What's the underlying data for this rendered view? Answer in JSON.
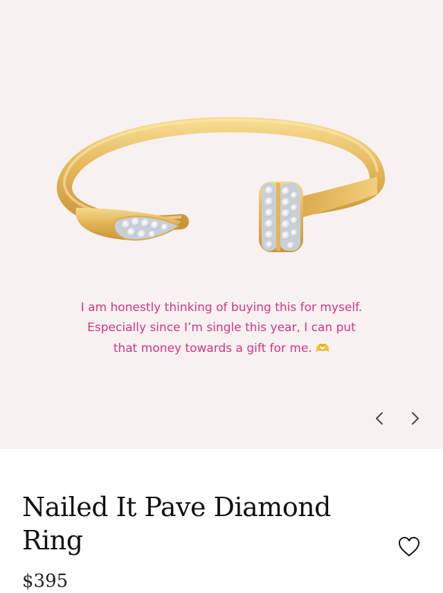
{
  "hero": {
    "caption_line1": "I am honestly thinking of buying this for myself.",
    "caption_line2": "Especially since I’m single this year, I can put",
    "caption_line3": "that money towards a gift for me.",
    "caption_emoji": "🫶",
    "caption_color": "#d63384",
    "background_color": "#f7f2f1",
    "prev_icon": "chevron-left-icon",
    "next_icon": "chevron-right-icon"
  },
  "product": {
    "title": "Nailed It Pave Diamond Ring",
    "price": "$395",
    "wishlist_icon": "heart-outline-icon"
  }
}
